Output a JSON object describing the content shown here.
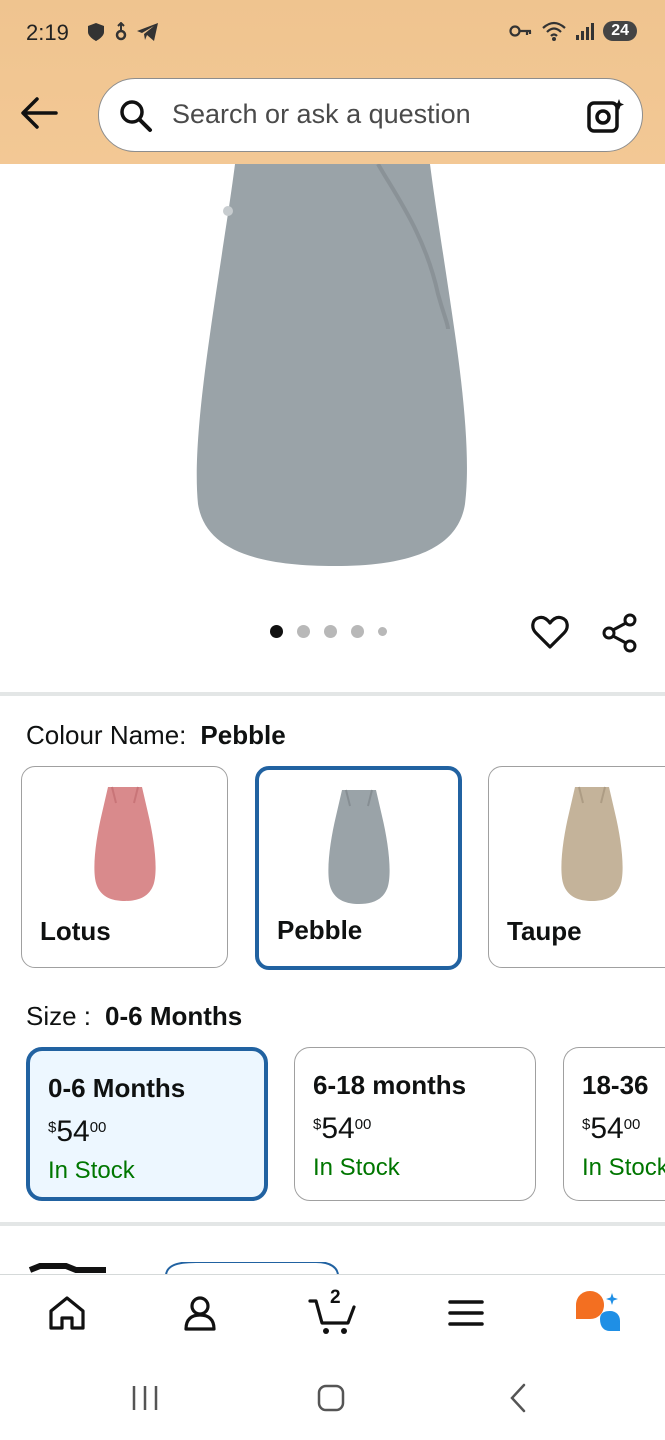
{
  "status_bar": {
    "time": "2:19",
    "battery": "24"
  },
  "search": {
    "placeholder": "Search or ask a question"
  },
  "gallery": {
    "image_count": 5,
    "active_index": 0
  },
  "colour": {
    "label": "Colour Name:",
    "selected": "Pebble",
    "options": [
      {
        "name": "Lotus",
        "color": "#d98a8c"
      },
      {
        "name": "Pebble",
        "color": "#9aa3a8"
      },
      {
        "name": "Taupe",
        "color": "#c4b39a"
      }
    ]
  },
  "size": {
    "label": "Size :",
    "selected": "0-6 Months",
    "options": [
      {
        "name": "0-6 Months",
        "currency": "$",
        "whole": "54",
        "fraction": "00",
        "stock": "In Stock"
      },
      {
        "name": "6-18 months",
        "currency": "$",
        "whole": "54",
        "fraction": "00",
        "stock": "In Stock"
      },
      {
        "name": "18-36",
        "currency": "$",
        "whole": "54",
        "fraction": "00",
        "stock": "In Stock"
      }
    ]
  },
  "bottom_nav": {
    "cart_count": "2",
    "items": [
      "home-icon",
      "account-icon",
      "cart-icon",
      "menu-icon",
      "rufus-icon"
    ]
  },
  "colors": {
    "header": "#f3c895",
    "selected_border": "#2162a1",
    "in_stock": "#007600",
    "product": "#9aa3a8"
  }
}
